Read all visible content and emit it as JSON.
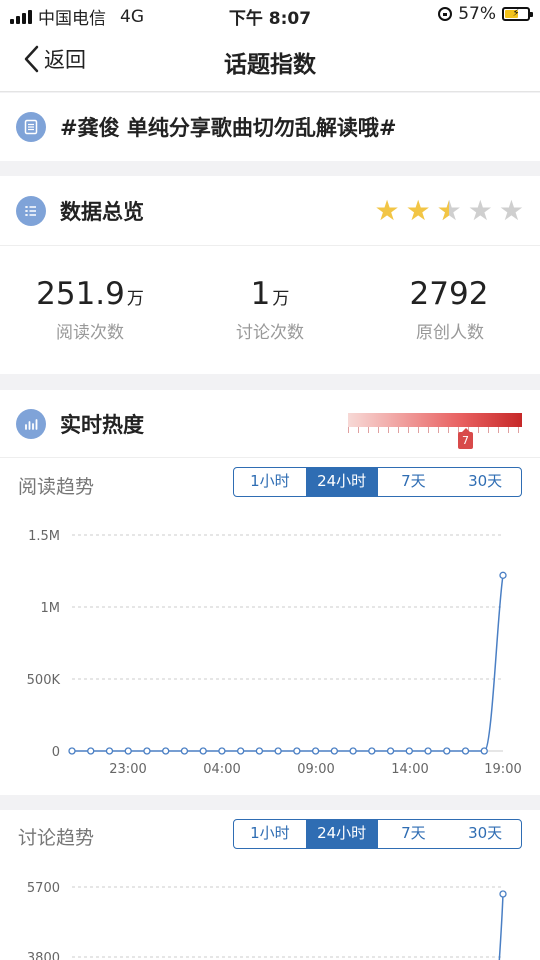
{
  "status_bar": {
    "carrier": "中国电信",
    "network": "4G",
    "time": "下午 8:07",
    "battery": "57%"
  },
  "nav": {
    "back_label": "返回",
    "title": "话题指数"
  },
  "topic": {
    "text": "#龚俊 单纯分享歌曲切勿乱解读哦#",
    "icon": "document-icon"
  },
  "overview": {
    "title": "数据总览",
    "icon": "list-icon",
    "rating": 2.5,
    "rating_max": 5,
    "stats": [
      {
        "value": "251.9",
        "unit": "万",
        "label": "阅读次数"
      },
      {
        "value": "1",
        "unit": "万",
        "label": "讨论次数"
      },
      {
        "value": "2792",
        "unit": "",
        "label": "原创人数"
      }
    ]
  },
  "heat": {
    "title": "实时热度",
    "icon": "chart-icon",
    "level": "7",
    "colors": [
      "#f7d9d6",
      "#e86060",
      "#c62828"
    ]
  },
  "tabs": [
    "1小时",
    "24小时",
    "7天",
    "30天"
  ],
  "active_tab": "24小时",
  "reading_trend": {
    "title": "阅读趋势"
  },
  "discussion_trend": {
    "title": "讨论趋势"
  },
  "chart_data": [
    {
      "type": "line",
      "y_tick_labels": [
        "1.5M",
        "1M",
        "500K",
        "0"
      ],
      "ylim": [
        0,
        1500000
      ],
      "x_tick_labels": [
        "23:00",
        "04:00",
        "09:00",
        "14:00",
        "19:00"
      ],
      "series": [
        {
          "values": [
            0,
            0,
            0,
            0,
            0,
            0,
            0,
            0,
            0,
            0,
            0,
            0,
            0,
            0,
            0,
            0,
            0,
            0,
            0,
            0,
            0,
            0,
            0,
            1220000
          ]
        }
      ],
      "color": "#4a7fc4"
    },
    {
      "type": "line",
      "y_tick_labels": [
        "5700",
        "3800"
      ],
      "series": [
        {
          "values": [
            5400
          ]
        }
      ],
      "color": "#4a7fc4"
    }
  ]
}
